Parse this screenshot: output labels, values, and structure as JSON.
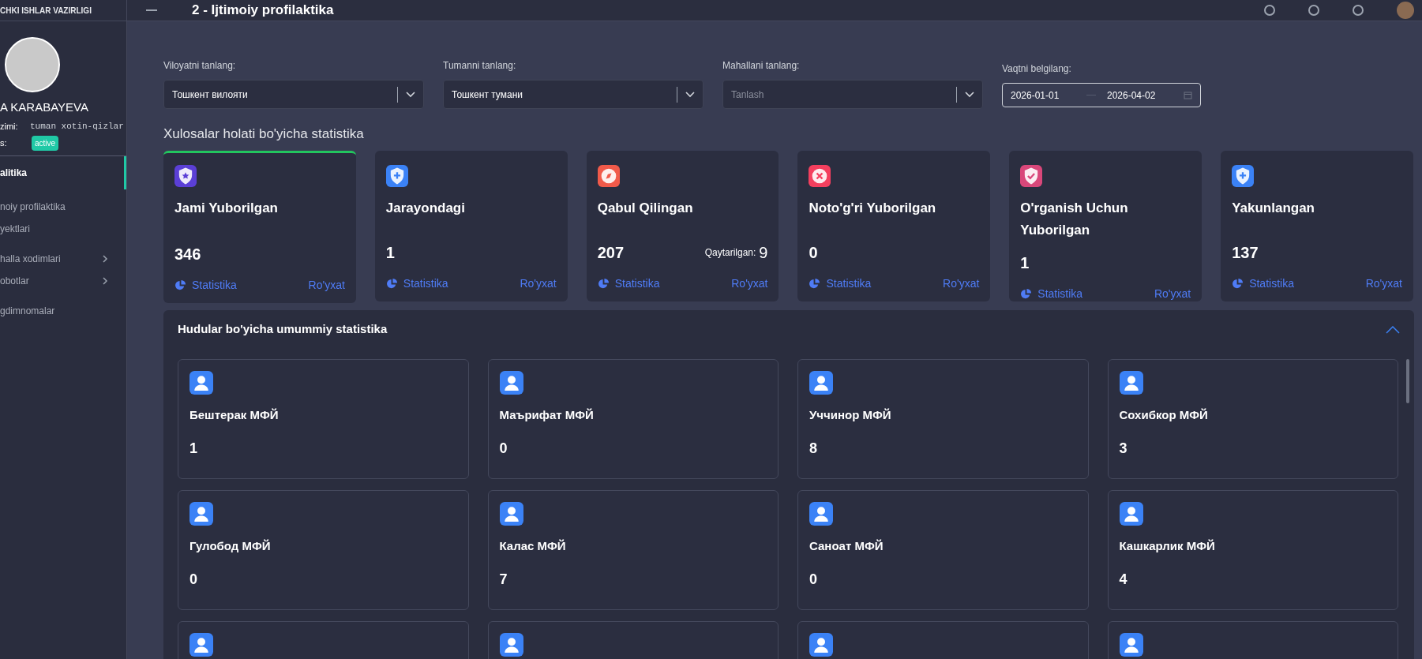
{
  "header": {
    "title": "2 - Ijtimoiy profilaktika"
  },
  "sidebar": {
    "org": "CHKI ISHLAR VAZIRLIGI",
    "user": {
      "name": "A KARABAYEVA",
      "fields": [
        {
          "label": "zimi:",
          "value": "tuman xotin-qizlar",
          "kind": "text"
        },
        {
          "label": "s:",
          "value": "active",
          "kind": "badge"
        }
      ]
    },
    "items": [
      {
        "label": "alitika",
        "selected": true,
        "expandable": false
      },
      {
        "label": "noiy profilaktika",
        "selected": false,
        "expandable": false
      },
      {
        "label": "yektlari",
        "selected": false,
        "expandable": false
      },
      {
        "label": "halla xodimlari",
        "selected": false,
        "expandable": true
      },
      {
        "label": "obotlar",
        "selected": false,
        "expandable": true
      },
      {
        "label": "gdimnomalar",
        "selected": false,
        "expandable": false
      }
    ]
  },
  "filters": [
    {
      "kind": "select",
      "label": "Viloyatni tanlang:",
      "value": "Тошкент вилояти"
    },
    {
      "kind": "select",
      "label": "Tumanni tanlang:",
      "value": "Тошкент тумани"
    },
    {
      "kind": "select",
      "label": "Mahallani tanlang:",
      "placeholder": "Tanlash"
    },
    {
      "kind": "daterange",
      "label": "Vaqtni belgilang:",
      "from": "2026-01-01",
      "to": "2026-04-02"
    }
  ],
  "status_title": "Xulosalar holati bo'yicha statistika",
  "status_cards": [
    {
      "title": "Jami Yuborilgan",
      "count": "346",
      "kind": "star",
      "color": "#5b3fd6",
      "selected": true,
      "links": [
        "Statistika",
        "Ro'yxat"
      ]
    },
    {
      "title": "Jarayondagi",
      "count": "1",
      "kind": "plus",
      "color": "#3b82f6",
      "selected": false,
      "links": [
        "Statistika",
        "Ro'yxat"
      ]
    },
    {
      "title": "Qabul Qilingan",
      "count": "207",
      "kind": "compass",
      "color": "#f15a4a",
      "selected": false,
      "extra_label": "Qaytarilgan:",
      "extra_value": "9",
      "links": [
        "Statistika",
        "Ro'yxat"
      ]
    },
    {
      "title": "Noto'g'ri Yuborilgan",
      "count": "0",
      "kind": "cross",
      "color": "#f43f5e",
      "selected": false,
      "links": [
        "Statistika",
        "Ro'yxat"
      ]
    },
    {
      "title": "O'rganish Uchun Yuborilgan",
      "count": "1",
      "kind": "check",
      "color": "#d9477a",
      "selected": false,
      "links": [
        "Statistika",
        "Ro'yxat"
      ]
    },
    {
      "title": "Yakunlangan",
      "count": "137",
      "kind": "plus",
      "color": "#3b82f6",
      "selected": false,
      "links": [
        "Statistika",
        "Ro'yxat"
      ]
    }
  ],
  "regions": {
    "title": "Hudular bo'yicha umummiy statistika",
    "expanded": true,
    "items": [
      {
        "kind": "full",
        "name": "Бештерак МФЙ",
        "value": "1"
      },
      {
        "kind": "full",
        "name": "Маърифат МФЙ",
        "value": "0"
      },
      {
        "kind": "full",
        "name": "Уччинор МФЙ",
        "value": "8"
      },
      {
        "kind": "full",
        "name": "Сохибкор МФЙ",
        "value": "3"
      },
      {
        "kind": "full",
        "name": "Гулобод МФЙ",
        "value": "0"
      },
      {
        "kind": "full",
        "name": "Калас МФЙ",
        "value": "7"
      },
      {
        "kind": "full",
        "name": "Саноат МФЙ",
        "value": "0"
      },
      {
        "kind": "full",
        "name": "Кашкарлик МФЙ",
        "value": "4"
      },
      {
        "kind": "partial"
      },
      {
        "kind": "partial"
      },
      {
        "kind": "partial"
      },
      {
        "kind": "partial"
      }
    ]
  }
}
